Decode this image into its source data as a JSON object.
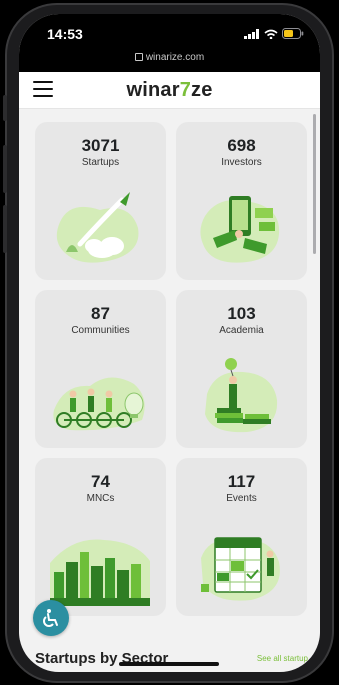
{
  "status": {
    "time": "14:53",
    "url": "winarize.com"
  },
  "header": {
    "logo_part1": "winar",
    "logo_mark": "7",
    "logo_part2": "ze"
  },
  "cards": [
    {
      "number": "3071",
      "label": "Startups",
      "icon": "rocket-illustration"
    },
    {
      "number": "698",
      "label": "Investors",
      "icon": "investor-phone-illustration"
    },
    {
      "number": "87",
      "label": "Communities",
      "icon": "cyclists-illustration"
    },
    {
      "number": "103",
      "label": "Academia",
      "icon": "graduate-books-illustration"
    },
    {
      "number": "74",
      "label": "MNCs",
      "icon": "city-skyline-illustration"
    },
    {
      "number": "117",
      "label": "Events",
      "icon": "calendar-illustration"
    }
  ],
  "section": {
    "title": "Startups by Sector",
    "see_all": "See all startup"
  },
  "colors": {
    "accent": "#7bbf3a",
    "accessibility": "#2b8fa1",
    "card": "#e7e7e7"
  }
}
